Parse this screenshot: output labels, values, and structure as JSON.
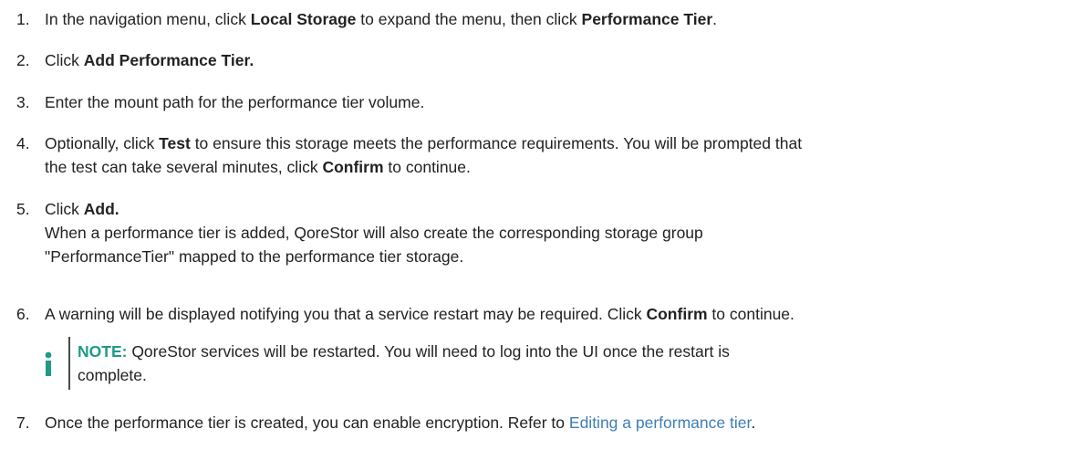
{
  "steps": [
    {
      "num": "1.",
      "parts": [
        "In the navigation menu, click ",
        "Local Storage",
        " to expand the menu, then click ",
        "Performance Tier",
        "."
      ]
    },
    {
      "num": "2.",
      "parts": [
        "Click ",
        "Add Performance Tier."
      ]
    },
    {
      "num": "3.",
      "parts": [
        "Enter the mount path for the performance tier volume."
      ]
    },
    {
      "num": "4.",
      "parts": [
        "Optionally, click ",
        "Test",
        " to ensure this storage meets the performance requirements. You will be prompted that",
        "the test can take several minutes, click ",
        "Confirm",
        " to continue."
      ]
    },
    {
      "num": "5.",
      "parts": [
        "Click ",
        "Add.",
        "When a performance tier is added, QoreStor will also create the corresponding storage group",
        "\"PerformanceTier\" mapped to the performance tier storage."
      ]
    },
    {
      "num": "6.",
      "parts": [
        "A warning will be displayed notifying you that a service restart may be required. Click ",
        "Confirm",
        " to continue."
      ]
    },
    {
      "num": "7.",
      "parts": [
        "Once the performance tier is created, you can enable encryption. Refer to ",
        "Editing a performance tier",
        "."
      ]
    }
  ],
  "note": {
    "label": "NOTE:",
    "text_line1": " QoreStor services will be restarted. You will need to log into the UI once the restart is",
    "text_line2": "complete.",
    "icon": "info-icon",
    "accent_color": "#1f9a86"
  },
  "colors": {
    "link": "#3d7fb8",
    "text": "#222222"
  }
}
